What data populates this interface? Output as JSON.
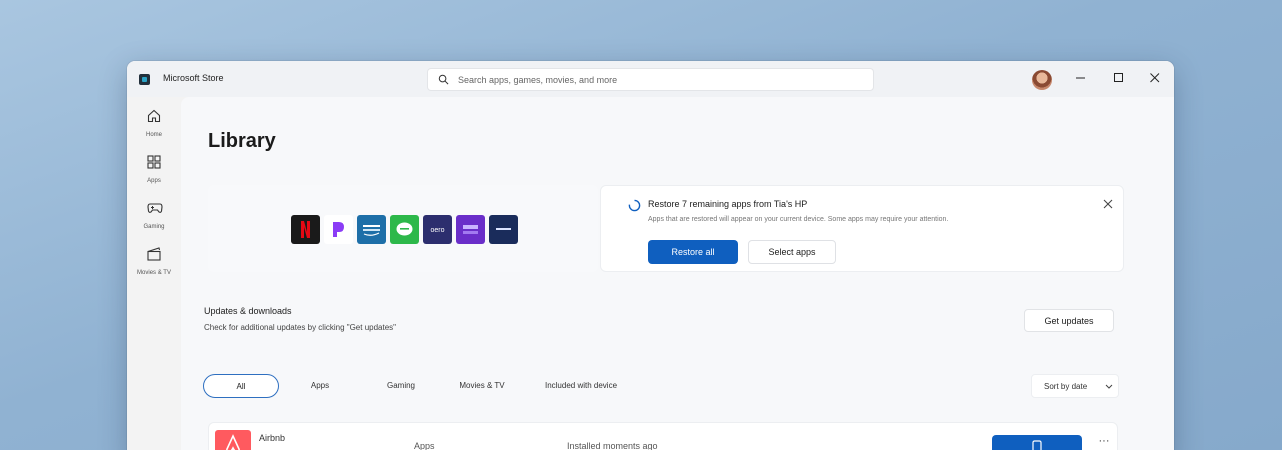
{
  "window": {
    "title": "Microsoft Store",
    "search": {
      "placeholder": "Search apps, games, movies, and more"
    },
    "controls": [
      "minimize",
      "maximize",
      "close"
    ]
  },
  "sidebar": {
    "items": [
      {
        "label": "Home",
        "icon": "home-icon"
      },
      {
        "label": "Apps",
        "icon": "apps-icon"
      },
      {
        "label": "Gaming",
        "icon": "gaming-icon"
      },
      {
        "label": "Movies & TV",
        "icon": "movies-tv-icon"
      }
    ]
  },
  "library": {
    "title": "Library",
    "featured_apps": [
      {
        "icon": "netflix-icon",
        "color": "#1a1a1a"
      },
      {
        "icon": "pandora-icon",
        "color": "#ffffff"
      },
      {
        "icon": "prime-video-icon",
        "color": "#1e6fa8"
      },
      {
        "icon": "line-icon",
        "color": "#2db84a"
      },
      {
        "icon": "vero-icon",
        "color": "#2c2e6e"
      },
      {
        "icon": "hbo-max-icon",
        "color": "#6a2ec9"
      },
      {
        "icon": "disney-plus-icon",
        "color": "#1a2c5b"
      }
    ],
    "restore": {
      "title": "Restore 7 remaining apps from Tia's HP",
      "description": "Apps that are restored will appear on your current device. Some apps may require your attention.",
      "primary_label": "Restore all",
      "secondary_label": "Select apps"
    },
    "updates": {
      "title": "Updates & downloads",
      "description": "Check for additional updates by clicking \"Get updates\"",
      "button_label": "Get updates"
    },
    "filters": [
      "All",
      "Apps",
      "Gaming",
      "Movies & TV",
      "Included with device"
    ],
    "active_filter": "All",
    "sort_label": "Sort by date",
    "rows": [
      {
        "name": "Airbnb",
        "type": "Apps",
        "status": "Installed moments ago",
        "icon": "airbnb-icon"
      }
    ]
  },
  "colors": {
    "accent": "#0f5fbf",
    "background": "#f7f8fa",
    "desktop": "#9fbedc"
  }
}
